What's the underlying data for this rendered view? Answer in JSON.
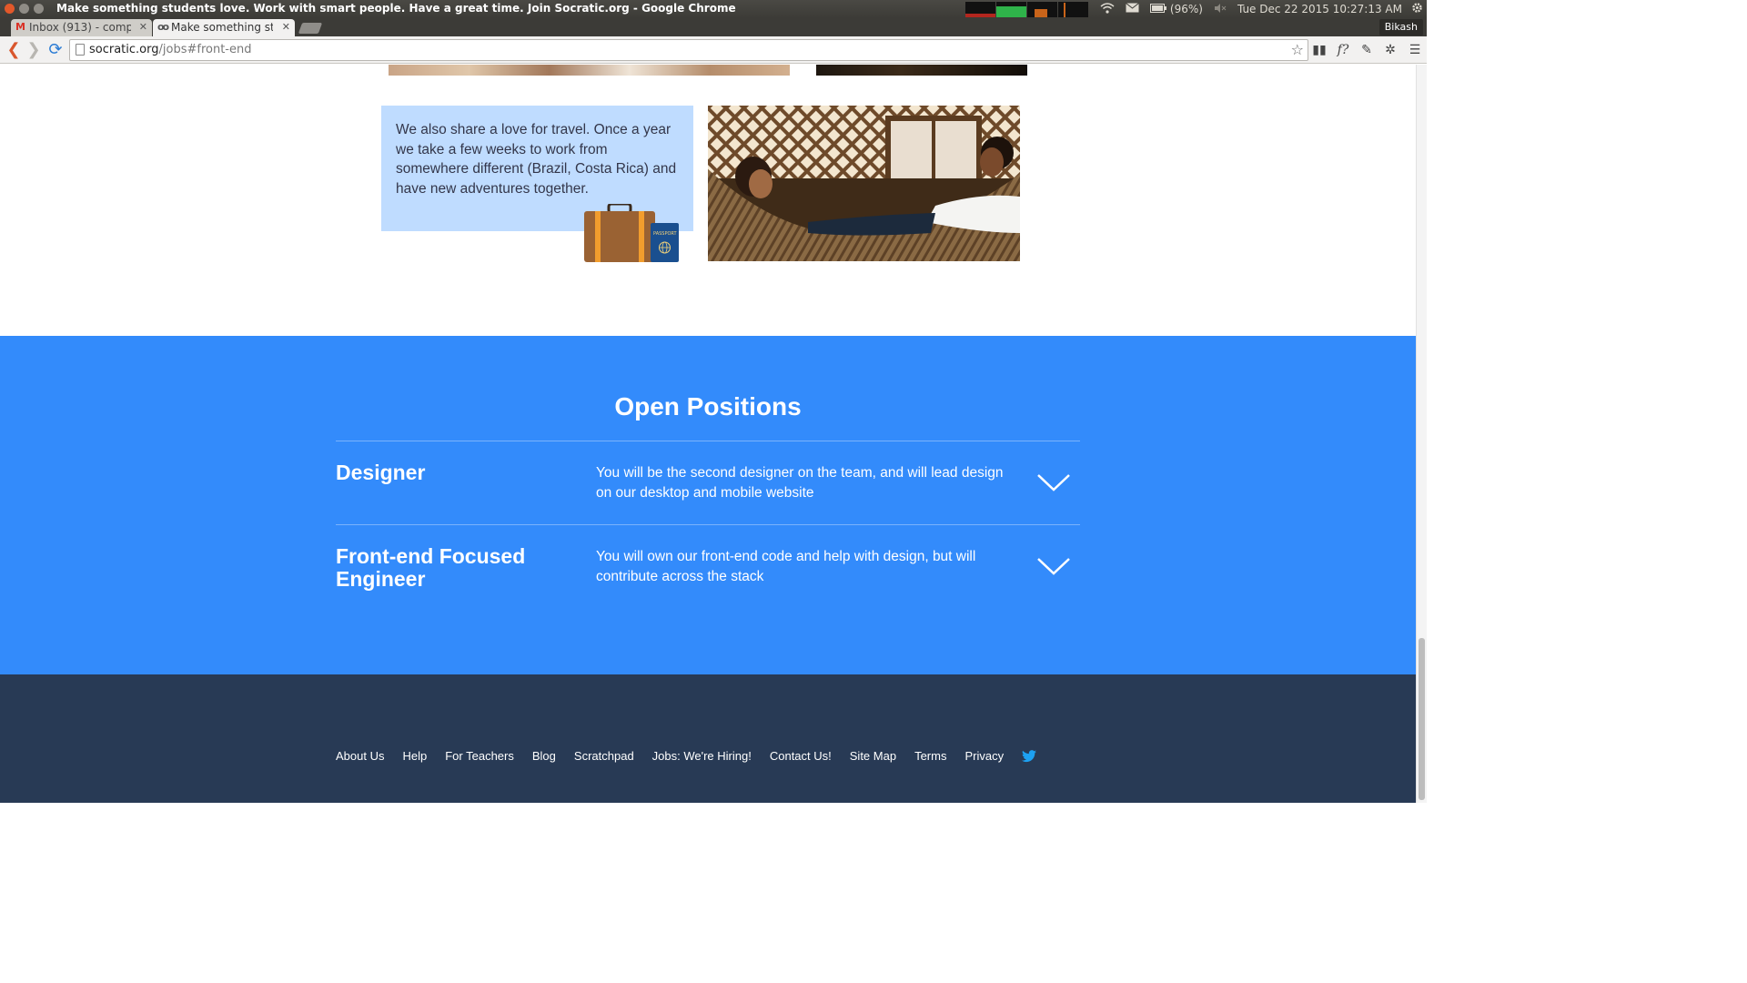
{
  "os": {
    "window_title": "Make something students love. Work with smart people. Have a great time. Join Socratic.org - Google Chrome",
    "battery": "(96%)",
    "datetime": "Tue Dec 22 2015 10:27:13 AM"
  },
  "browser": {
    "tabs": [
      {
        "label": "Inbox (913) - comput",
        "favicon": "gmail-icon"
      },
      {
        "label": "Make something stu",
        "favicon": "socratic-owl-icon"
      }
    ],
    "user": "Bikash",
    "url_host": "socratic.org",
    "url_path": "/jobs#front-end"
  },
  "travel": {
    "text": "We also share a love for travel. Once a year we take a few weeks to work from somewhere different (Brazil, Costa Rica) and have new adventures together.",
    "passport_label": "PASSPORT"
  },
  "positions": {
    "title": "Open Positions",
    "items": [
      {
        "title": "Designer",
        "desc": "You will be the second designer on the team, and will lead design on our desktop and mobile website"
      },
      {
        "title": "Front-end Focused Engineer",
        "desc": "You will own our front-end code and help with design, but will contribute across the stack"
      }
    ]
  },
  "footer": {
    "links": [
      "About Us",
      "Help",
      "For Teachers",
      "Blog",
      "Scratchpad",
      "Jobs: We're Hiring!",
      "Contact Us!",
      "Site Map",
      "Terms",
      "Privacy"
    ]
  },
  "colors": {
    "positions_bg": "#338bfb",
    "footer_bg": "#283a55",
    "travel_card_bg": "#bfdcff",
    "twitter": "#1da1f2"
  }
}
